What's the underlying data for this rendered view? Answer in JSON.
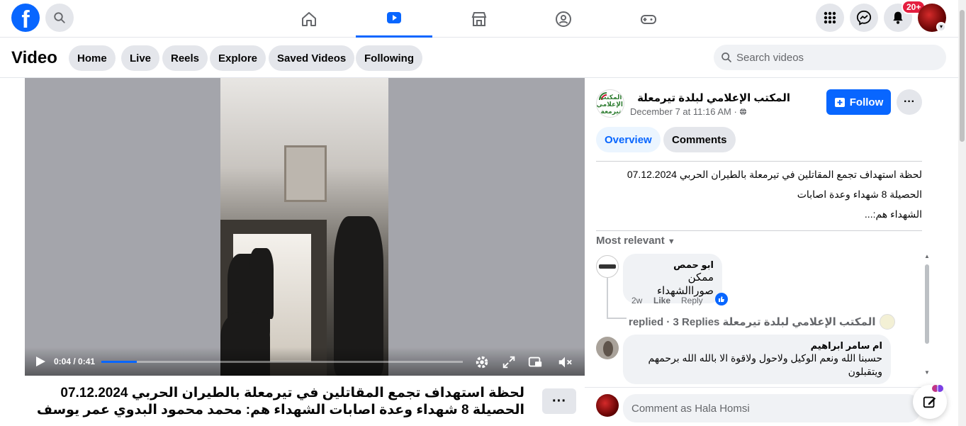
{
  "topbar": {
    "logo": "f",
    "notification_count": "20+",
    "nav": [
      {
        "name": "home",
        "active": false
      },
      {
        "name": "video",
        "active": true
      },
      {
        "name": "marketplace",
        "active": false
      },
      {
        "name": "groups",
        "active": false
      },
      {
        "name": "gaming",
        "active": false
      }
    ]
  },
  "subbar": {
    "title": "Video",
    "chips": [
      "Home",
      "Live",
      "Reels",
      "Explore",
      "Saved Videos",
      "Following"
    ],
    "search_placeholder": "Search videos"
  },
  "player": {
    "time": "0:04 / 0:41",
    "progress_fraction": 0.0976
  },
  "video_title": "لحظة استهداف تجمع المقاتلين في تيرمعلة بالطيران الحربي 07.12.2024 الحصيلة 8 شهداء وعدة اصابات الشهداء هم: محمد محمود البدوي عمر يوسف المصري محمود...",
  "post": {
    "page_avatar_text": "المكتب الإعلامي تيرمعة",
    "page_name": "المكتب الإعلامي لبلدة تيرمعلة",
    "time": "December 7 at 11:16 AM · ",
    "follow_label": "Follow",
    "tabs": [
      "Overview",
      "Comments"
    ],
    "description": [
      "لحظة استهداف تجمع المقاتلين في تيرمعلة بالطيران الحربي 07.12.2024",
      "الحصيلة 8 شهداء وعدة اصابات",
      "الشهداء هم:..."
    ]
  },
  "comments": {
    "sort_label": "Most relevant",
    "items": [
      {
        "author": "ابو حمص",
        "text": "ممكن صوراالشهداء",
        "age": "2w",
        "like": "Like",
        "reply": "Reply"
      },
      {
        "author": "ام سامر ابراهيم",
        "text": "حسبنا الله ونعم الوكيل ولاحول ولاقوة الا بالله الله برحمهم ويتقبلون"
      }
    ],
    "replies_text": "المكتب الإعلامي لبلدة تيرمعلة replied · 3 Replies",
    "compose_placeholder": "Comment as Hala Homsi"
  },
  "colors": {
    "accent": "#0866ff",
    "badge": "#e41e3f",
    "chip_bg": "#e4e6eb"
  }
}
